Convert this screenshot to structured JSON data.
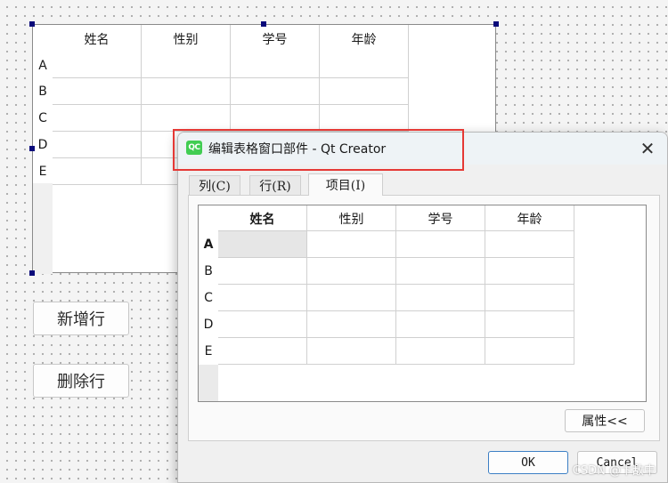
{
  "designer": {
    "columns": [
      "姓名",
      "性别",
      "学号",
      "年龄"
    ],
    "rows": [
      "A",
      "B",
      "C",
      "D",
      "E"
    ],
    "add_row_button": "新增行",
    "delete_row_button": "删除行"
  },
  "dialog": {
    "icon_text": "QC",
    "title": "编辑表格窗口部件 - Qt Creator",
    "close_glyph": "✕",
    "tabs": [
      {
        "label": "列(C)"
      },
      {
        "label": "行(R)"
      },
      {
        "label": "项目(I)",
        "active": true
      }
    ],
    "table": {
      "columns": [
        "姓名",
        "性别",
        "学号",
        "年龄"
      ],
      "rows": [
        "A",
        "B",
        "C",
        "D",
        "E"
      ],
      "selected_cell": {
        "row": "A",
        "column": "姓名"
      }
    },
    "properties_button": "属性<<",
    "ok_button": "OK",
    "cancel_button": "Cancel"
  },
  "watermark": "CSDN @卞敌中",
  "colors": {
    "highlight": "#e53935",
    "qt_green": "#41cd52",
    "ok_border": "#3c7fc4"
  }
}
